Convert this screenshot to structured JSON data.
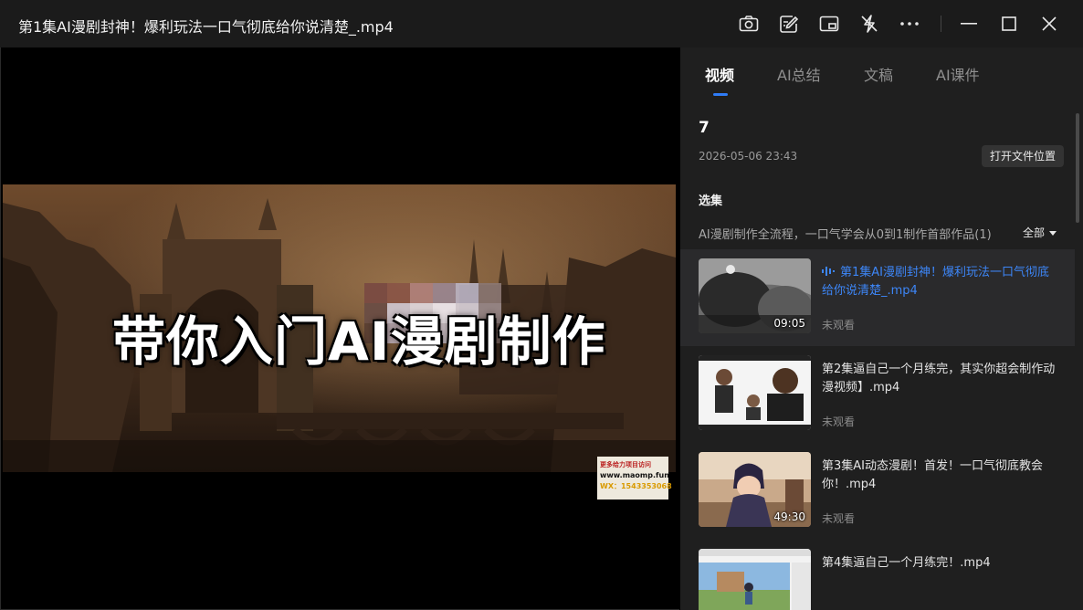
{
  "window": {
    "title": "第1集AI漫剧封神！爆利玩法一口气彻底给你说清楚_.mp4",
    "toolbar_icons": [
      "camera-icon",
      "edit-note-icon",
      "picture-in-picture-icon",
      "no-flash-icon",
      "more-icon"
    ],
    "window_controls": [
      "minimize-icon",
      "maximize-icon",
      "close-icon"
    ]
  },
  "video": {
    "caption": "带你入门AI漫剧制作",
    "watermark": {
      "line1": "更多给力项目访问",
      "line2": "www.maomp.fun",
      "line3": "WX：1543353068"
    }
  },
  "panel": {
    "tabs": [
      {
        "label": "视频",
        "active": true
      },
      {
        "label": "AI总结",
        "active": false
      },
      {
        "label": "文稿",
        "active": false
      },
      {
        "label": "AI课件",
        "active": false
      }
    ],
    "info": {
      "title": "7",
      "date": "2026-05-06 23:43",
      "open_folder_label": "打开文件位置"
    },
    "section_label": "选集",
    "playlist_name": "AI漫剧制作全流程，一口气学会从0到1制作首部作品(1)",
    "filter_label": "全部",
    "episodes": [
      {
        "title": "第1集AI漫剧封神！爆利玩法一口气彻底给你说清楚_.mp4",
        "duration": "09:05",
        "status": "未观看",
        "active": true
      },
      {
        "title": "第2集逼自己一个月练完，其实你超会制作动漫视频】.mp4",
        "duration": "",
        "status": "未观看",
        "active": false
      },
      {
        "title": "第3集AI动态漫剧！首发！一口气彻底教会你！.mp4",
        "duration": "49:30",
        "status": "未观看",
        "active": false
      },
      {
        "title": "第4集逼自己一个月练完！.mp4",
        "duration": "",
        "status": "",
        "active": false
      }
    ]
  },
  "colors": {
    "accent": "#3d86f7",
    "panel_bg": "#1f1f1f",
    "titlebar_bg": "#1b1b1b"
  }
}
